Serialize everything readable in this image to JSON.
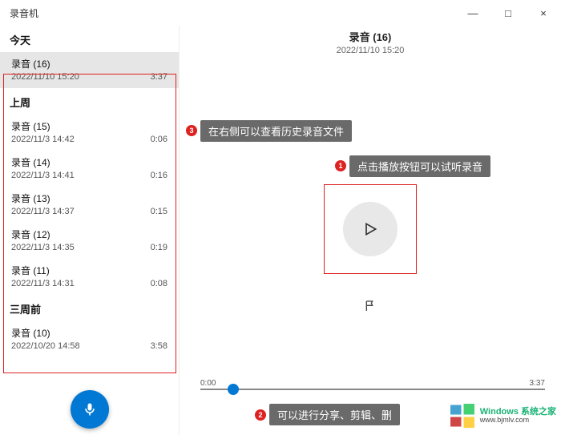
{
  "app_title": "录音机",
  "window_controls": {
    "min": "—",
    "max": "□",
    "close": "×"
  },
  "detail": {
    "title": "录音 (16)",
    "date": "2022/11/10 15:20"
  },
  "timeline": {
    "start": "0:00",
    "end": "3:37"
  },
  "sections": {
    "today": "今天",
    "last_week": "上周",
    "three_weeks_ago": "三周前"
  },
  "recordings": {
    "today": [
      {
        "title": "录音 (16)",
        "date": "2022/11/10 15:20",
        "dur": "3:37"
      }
    ],
    "last_week": [
      {
        "title": "录音 (15)",
        "date": "2022/11/3 14:42",
        "dur": "0:06"
      },
      {
        "title": "录音 (14)",
        "date": "2022/11/3 14:41",
        "dur": "0:16"
      },
      {
        "title": "录音 (13)",
        "date": "2022/11/3 14:37",
        "dur": "0:15"
      },
      {
        "title": "录音 (12)",
        "date": "2022/11/3 14:35",
        "dur": "0:19"
      },
      {
        "title": "录音 (11)",
        "date": "2022/11/3 14:31",
        "dur": "0:08"
      }
    ],
    "three_weeks_ago": [
      {
        "title": "录音 (10)",
        "date": "2022/10/20 14:58",
        "dur": "3:58"
      }
    ]
  },
  "callouts": {
    "c1": "点击播放按钮可以试听录音",
    "c2": "可以进行分享、剪辑、删",
    "c3": "在右侧可以查看历史录音文件"
  },
  "watermark": {
    "line1": "Windows 系统之家",
    "line2": "www.bjmlv.com"
  }
}
